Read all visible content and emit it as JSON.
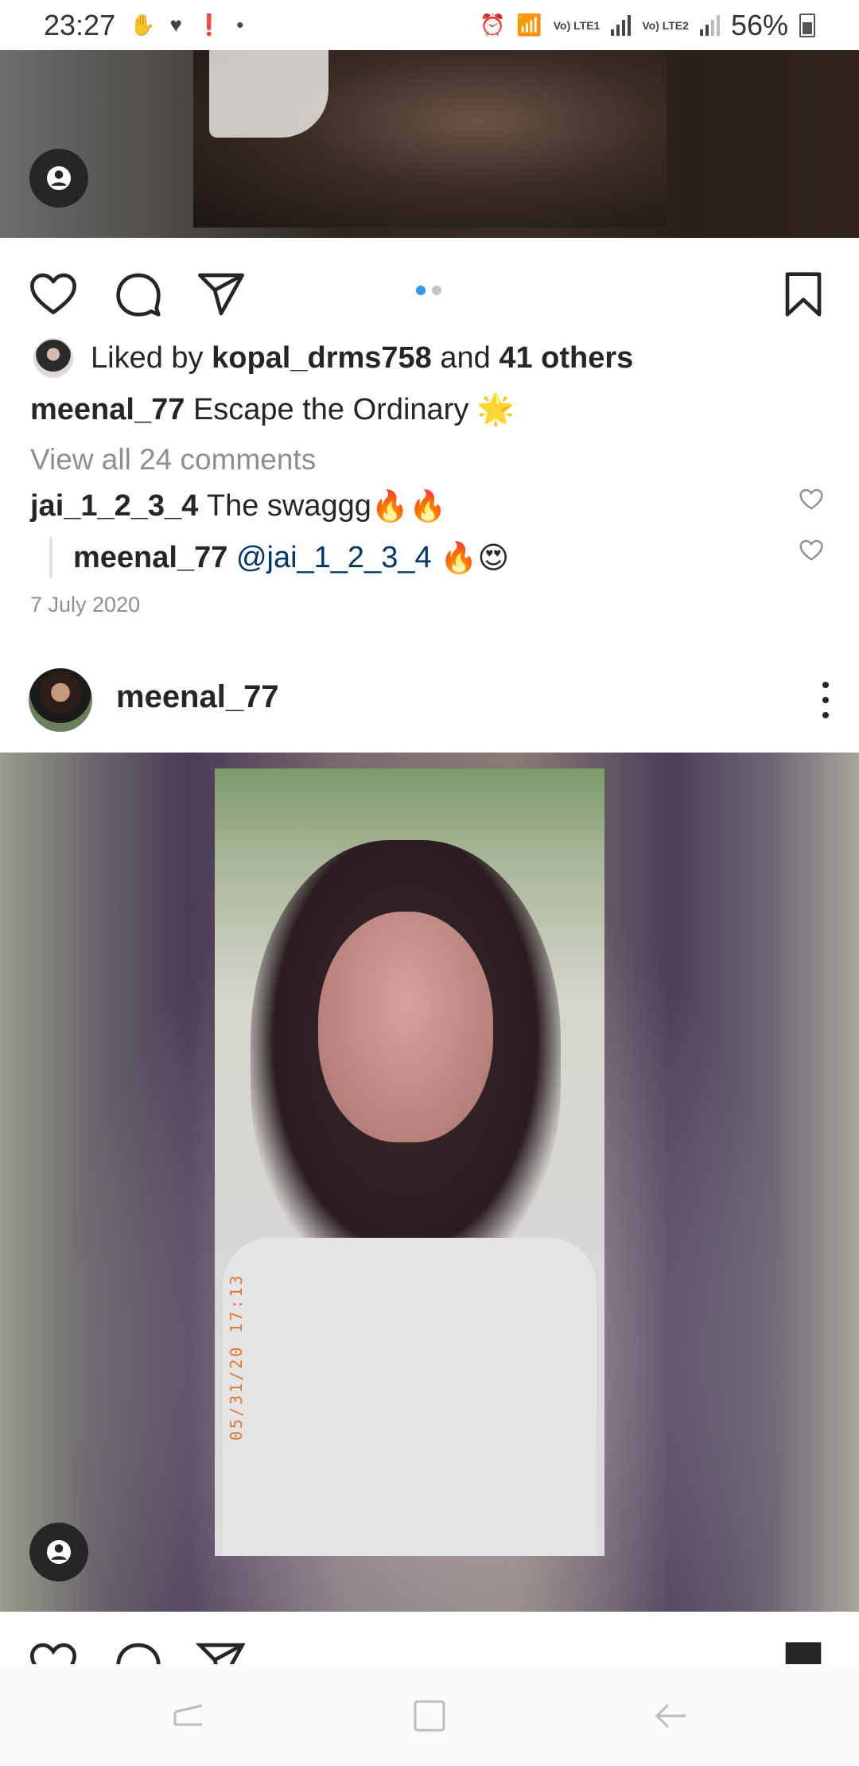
{
  "status_bar": {
    "time": "23:27",
    "battery_percent": "56%",
    "network_1": "Vo) LTE1",
    "network_2": "Vo) LTE2",
    "left_icons": [
      "hand-icon",
      "heart-pulse-icon",
      "alert-icon",
      "dot-icon"
    ],
    "right_icons": [
      "alarm-icon",
      "wifi-icon",
      "signal-icon",
      "signal-icon",
      "battery-icon"
    ]
  },
  "post1": {
    "carousel": {
      "count": 2,
      "active_index": 0
    },
    "liked_by": {
      "prefix": "Liked by",
      "user": "kopal_drms758",
      "middle": "and",
      "others": "41 others"
    },
    "caption": {
      "username": "meenal_77",
      "text": "Escape the Ordinary",
      "emoji": "🌟"
    },
    "view_all_comments": "View all 24 comments",
    "comment": {
      "username": "jai_1_2_3_4",
      "text": "The swaggg",
      "emoji": "🔥🔥"
    },
    "reply": {
      "username": "meenal_77",
      "mention": "@jai_1_2_3_4",
      "emoji": "🔥😍"
    },
    "date": "7 July 2020"
  },
  "post2": {
    "username": "meenal_77",
    "photo_stamp": "05/31/20 17:13"
  },
  "colors": {
    "text": "#262626",
    "secondary": "#8e8e8e",
    "accent_dot": "#3897f0",
    "mention": "#00376b"
  }
}
